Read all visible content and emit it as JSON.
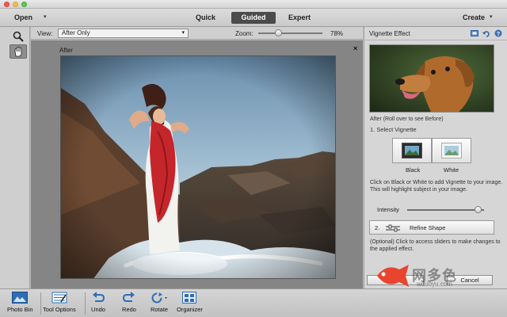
{
  "window": {
    "controls": [
      "close",
      "minimize",
      "zoom"
    ]
  },
  "toolbar": {
    "open_label": "Open",
    "modes": {
      "quick": "Quick",
      "guided": "Guided",
      "expert": "Expert"
    },
    "active_mode": "Guided",
    "create_label": "Create"
  },
  "tools": [
    {
      "name": "zoom-tool",
      "icon": "magnifier-icon",
      "selected": false
    },
    {
      "name": "hand-tool",
      "icon": "hand-icon",
      "selected": true
    }
  ],
  "options": {
    "view_label": "View:",
    "view_value": "After Only",
    "zoom_label": "Zoom:",
    "zoom_value": "78%"
  },
  "canvas": {
    "label": "After",
    "close_glyph": "×"
  },
  "panel": {
    "title": "Vignette Effect",
    "header_icons": [
      "screen-icon",
      "reset-icon",
      "help-icon"
    ],
    "rollover_text": "After (Roll over to see Before)",
    "step1": "1. Select Vignette",
    "black_label": "Black",
    "white_label": "White",
    "instructions": "Click on Black or White to add Vignette to your image. This will highlight subject in your image.",
    "intensity_label": "Intensity",
    "intensity_level": 0.92,
    "refine_number": "2.",
    "refine_label": "Refine Shape",
    "optional_text": "(Optional) Click to access sliders to make changes to the applied effect.",
    "done_label": "Done",
    "cancel_label": "Cancel",
    "watermark_text": "网多色",
    "watermark_url": "wduoyu.com"
  },
  "bottom_bar": {
    "photo_bin": "Photo Bin",
    "tool_options": "Tool Options",
    "undo": "Undo",
    "redo": "Redo",
    "rotate": "Rotate",
    "organizer": "Organizer"
  },
  "colors": {
    "accent_dark": "#4b4b4b",
    "panel_bg": "#d6d6d6",
    "canvas_bg": "#858585",
    "dress_red": "#c4262b",
    "watermark_fish": "#e8452f"
  }
}
